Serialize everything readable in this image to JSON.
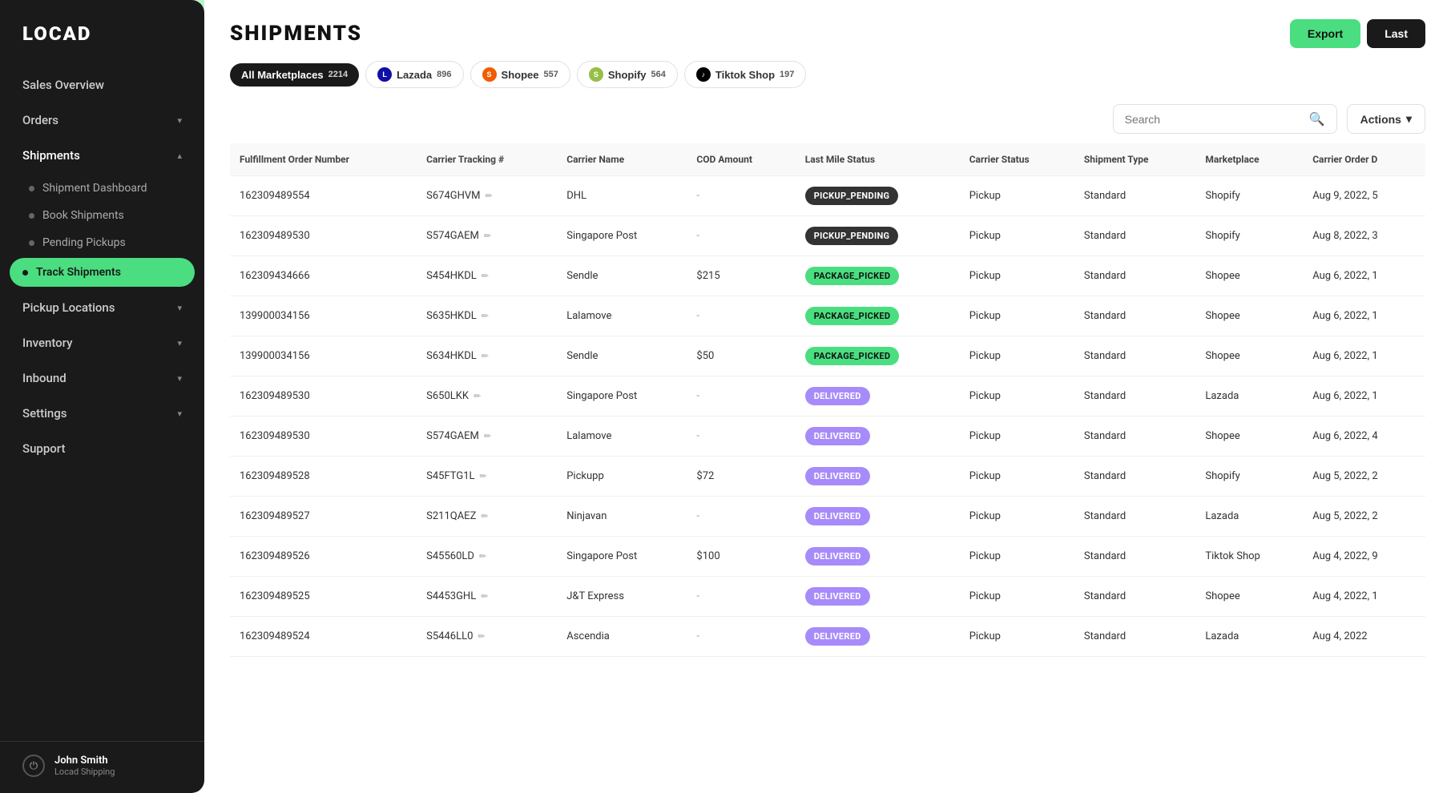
{
  "sidebar": {
    "logo": "LOCAD",
    "nav_items": [
      {
        "id": "sales-overview",
        "label": "Sales Overview",
        "expandable": false
      },
      {
        "id": "orders",
        "label": "Orders",
        "expandable": true
      },
      {
        "id": "shipments",
        "label": "Shipments",
        "expandable": true,
        "expanded": true,
        "sub_items": [
          {
            "id": "shipment-dashboard",
            "label": "Shipment Dashboard",
            "active": false
          },
          {
            "id": "book-shipments",
            "label": "Book Shipments",
            "active": false
          },
          {
            "id": "pending-pickups",
            "label": "Pending Pickups",
            "active": false
          },
          {
            "id": "track-shipments",
            "label": "Track Shipments",
            "active": true
          }
        ]
      },
      {
        "id": "pickup-locations",
        "label": "Pickup Locations",
        "expandable": true
      },
      {
        "id": "inventory",
        "label": "Inventory",
        "expandable": true
      },
      {
        "id": "inbound",
        "label": "Inbound",
        "expandable": true
      },
      {
        "id": "settings",
        "label": "Settings",
        "expandable": true
      },
      {
        "id": "support",
        "label": "Support",
        "expandable": false
      }
    ],
    "user": {
      "name": "John Smith",
      "company": "Locad Shipping"
    }
  },
  "header": {
    "title": "SHIPMENTS",
    "export_label": "Export",
    "last_label": "Last"
  },
  "marketplace_tabs": [
    {
      "id": "all",
      "label": "All Marketplaces",
      "count": "2214",
      "active": true,
      "icon": null
    },
    {
      "id": "lazada",
      "label": "Lazada",
      "count": "896",
      "active": false,
      "icon": "L",
      "icon_class": "lazada-icon"
    },
    {
      "id": "shopee",
      "label": "Shopee",
      "count": "557",
      "active": false,
      "icon": "S",
      "icon_class": "shopee-icon"
    },
    {
      "id": "shopify",
      "label": "Shopify",
      "count": "564",
      "active": false,
      "icon": "S",
      "icon_class": "shopify-icon"
    },
    {
      "id": "tiktok",
      "label": "Tiktok Shop",
      "count": "197",
      "active": false,
      "icon": "T",
      "icon_class": "tiktok-icon"
    }
  ],
  "filter_bar": {
    "search_placeholder": "Search",
    "actions_label": "Actions"
  },
  "table": {
    "columns": [
      "Fulfillment Order Number",
      "Carrier Tracking #",
      "Carrier Name",
      "COD Amount",
      "Last Mile Status",
      "Carrier Status",
      "Shipment Type",
      "Marketplace",
      "Carrier Order D"
    ],
    "rows": [
      {
        "order_number": "162309489554",
        "tracking": "S674GHVM",
        "carrier": "DHL",
        "cod": "-",
        "last_mile_status": "PICKUP_PENDING",
        "last_mile_class": "pickup-pending",
        "carrier_status": "Pickup",
        "shipment_type": "Standard",
        "marketplace": "Shopify",
        "carrier_order_date": "Aug 9, 2022, 5"
      },
      {
        "order_number": "162309489530",
        "tracking": "S574GAEM",
        "carrier": "Singapore Post",
        "cod": "-",
        "last_mile_status": "PICKUP_PENDING",
        "last_mile_class": "pickup-pending",
        "carrier_status": "Pickup",
        "shipment_type": "Standard",
        "marketplace": "Shopify",
        "carrier_order_date": "Aug 8, 2022, 3"
      },
      {
        "order_number": "162309434666",
        "tracking": "S454HKDL",
        "carrier": "Sendle",
        "cod": "$215",
        "last_mile_status": "PACKAGE_PICKED",
        "last_mile_class": "package-picked",
        "carrier_status": "Pickup",
        "shipment_type": "Standard",
        "marketplace": "Shopee",
        "carrier_order_date": "Aug 6, 2022, 1"
      },
      {
        "order_number": "139900034156",
        "tracking": "S635HKDL",
        "carrier": "Lalamove",
        "cod": "-",
        "last_mile_status": "PACKAGE_PICKED",
        "last_mile_class": "package-picked",
        "carrier_status": "Pickup",
        "shipment_type": "Standard",
        "marketplace": "Shopee",
        "carrier_order_date": "Aug 6, 2022, 1"
      },
      {
        "order_number": "139900034156",
        "tracking": "S634HKDL",
        "carrier": "Sendle",
        "cod": "$50",
        "last_mile_status": "PACKAGE_PICKED",
        "last_mile_class": "package-picked",
        "carrier_status": "Pickup",
        "shipment_type": "Standard",
        "marketplace": "Shopee",
        "carrier_order_date": "Aug 6, 2022, 1"
      },
      {
        "order_number": "162309489530",
        "tracking": "S650LKK",
        "carrier": "Singapore Post",
        "cod": "-",
        "last_mile_status": "DELIVERED",
        "last_mile_class": "delivered",
        "carrier_status": "Pickup",
        "shipment_type": "Standard",
        "marketplace": "Lazada",
        "carrier_order_date": "Aug 6, 2022, 1"
      },
      {
        "order_number": "162309489530",
        "tracking": "S574GAEM",
        "carrier": "Lalamove",
        "cod": "-",
        "last_mile_status": "DELIVERED",
        "last_mile_class": "delivered",
        "carrier_status": "Pickup",
        "shipment_type": "Standard",
        "marketplace": "Shopee",
        "carrier_order_date": "Aug 6, 2022, 4"
      },
      {
        "order_number": "162309489528",
        "tracking": "S45FTG1L",
        "carrier": "Pickupp",
        "cod": "$72",
        "last_mile_status": "DELIVERED",
        "last_mile_class": "delivered",
        "carrier_status": "Pickup",
        "shipment_type": "Standard",
        "marketplace": "Shopify",
        "carrier_order_date": "Aug 5, 2022, 2"
      },
      {
        "order_number": "162309489527",
        "tracking": "S211QAEZ",
        "carrier": "Ninjavan",
        "cod": "-",
        "last_mile_status": "DELIVERED",
        "last_mile_class": "delivered",
        "carrier_status": "Pickup",
        "shipment_type": "Standard",
        "marketplace": "Lazada",
        "carrier_order_date": "Aug 5, 2022, 2"
      },
      {
        "order_number": "162309489526",
        "tracking": "S45560LD",
        "carrier": "Singapore Post",
        "cod": "$100",
        "last_mile_status": "DELIVERED",
        "last_mile_class": "delivered",
        "carrier_status": "Pickup",
        "shipment_type": "Standard",
        "marketplace": "Tiktok Shop",
        "carrier_order_date": "Aug 4, 2022, 9"
      },
      {
        "order_number": "162309489525",
        "tracking": "S4453GHL",
        "carrier": "J&T Express",
        "cod": "-",
        "last_mile_status": "DELIVERED",
        "last_mile_class": "delivered",
        "carrier_status": "Pickup",
        "shipment_type": "Standard",
        "marketplace": "Shopee",
        "carrier_order_date": "Aug 4, 2022, 1"
      },
      {
        "order_number": "162309489524",
        "tracking": "S5446LL0",
        "carrier": "Ascendia",
        "cod": "-",
        "last_mile_status": "DELIVERED",
        "last_mile_class": "delivered",
        "carrier_status": "Pickup",
        "shipment_type": "Standard",
        "marketplace": "Lazada",
        "carrier_order_date": "Aug 4, 2022"
      }
    ]
  }
}
